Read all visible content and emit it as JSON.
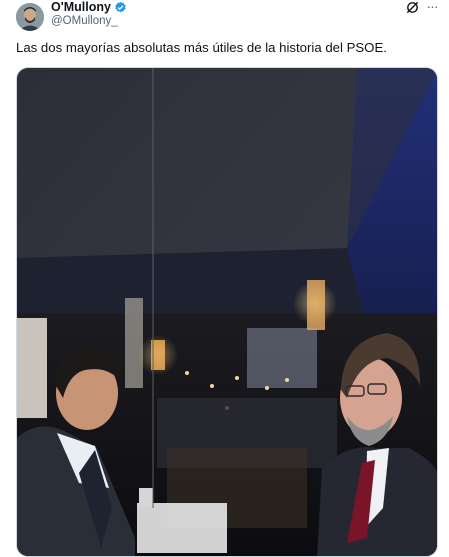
{
  "author": {
    "display_name": "O'Mullony",
    "handle": "@OMullony_",
    "verified": true,
    "avatar_icon": "profile-avatar"
  },
  "tweet": {
    "text": "Las dos mayorías absolutas más útiles de la historia del PSOE."
  },
  "actions": {
    "grok_icon": "grok-slash-circle-icon",
    "more_icon": "more-dots-icon",
    "more_glyph": "···"
  },
  "colors": {
    "verified_blue": "#1d9bf0",
    "text_primary": "#0f1419",
    "text_secondary": "#536471"
  }
}
